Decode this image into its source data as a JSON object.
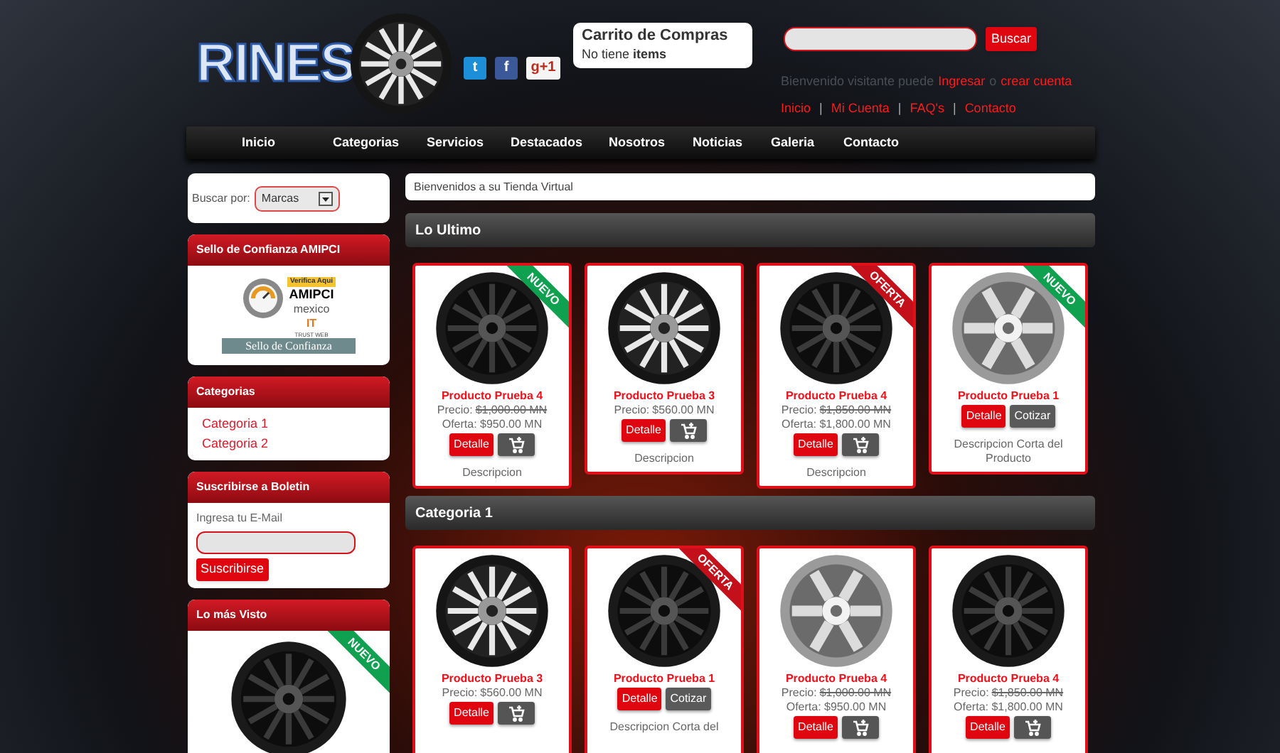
{
  "logo": {
    "text": "RINES"
  },
  "social": [
    {
      "kind": "twitter",
      "label": "t"
    },
    {
      "kind": "facebook",
      "label": "f"
    },
    {
      "kind": "gplus",
      "label": "g+1"
    }
  ],
  "cart": {
    "title": "Carrito de Compras",
    "status": "No tiene **items**"
  },
  "search": {
    "button": "Buscar"
  },
  "account": {
    "greeting": "Bienvenido visitante puede",
    "login": "Ingresar",
    "separator": "o",
    "register": "crear cuenta"
  },
  "top_links": {
    "separator": "|",
    "items": [
      "Inicio",
      "Mi Cuenta",
      "FAQ's",
      "Contacto"
    ]
  },
  "nav": [
    "Inicio",
    "Categorias",
    "Servicios",
    "Destacados",
    "Nosotros",
    "Noticias",
    "Galeria",
    "Contacto"
  ],
  "sidebar": {
    "search_by": {
      "label": "Buscar por:",
      "value": "Marcas"
    },
    "seal": {
      "title": "Sello de Confianza AMIPCI",
      "badge_top": "Verifica Aqui",
      "badge_brand": "AMIPCI",
      "badge_mexico": "mexico",
      "badge_it": "IT",
      "badge_trust": "TRUST WEB",
      "badge_bottom": "Sello de Confianza"
    },
    "categories": {
      "title": "Categorias",
      "items": [
        "Categoria 1",
        "Categoria 2"
      ]
    },
    "newsletter": {
      "title": "Suscribirse a Boletin",
      "label": "Ingresa tu E-Mail",
      "button": "Suscribirse"
    },
    "most_viewed": {
      "title": "Lo más Visto",
      "ribbon": {
        "kind": "new",
        "text": "NUEVO"
      }
    }
  },
  "welcome": "Bienvenidos a su Tienda Virtual",
  "sections": [
    {
      "title": "Lo Ultimo",
      "products": [
        {
          "kind": "black",
          "ribbon": {
            "kind": "new",
            "text": "NUEVO"
          },
          "name": "Producto Prueba 4",
          "price_label": "Precio:",
          "price": "$1,000.00 MN",
          "struck": true,
          "offer": "Oferta: $950.00 MN",
          "detail": "Detalle",
          "action": {
            "kind": "cart"
          },
          "description": "Descripcion"
        },
        {
          "kind": "chrome",
          "name": "Producto Prueba 3",
          "price_label": "Precio:",
          "price": "$560.00 MN",
          "struck": false,
          "detail": "Detalle",
          "action": {
            "kind": "cart"
          },
          "description": "Descripcion"
        },
        {
          "kind": "black",
          "ribbon": {
            "kind": "sale",
            "text": "OFERTA"
          },
          "name": "Producto Prueba 4",
          "price_label": "Precio:",
          "price": "$1,850.00 MN",
          "struck": true,
          "offer": "Oferta: $1,800.00 MN",
          "detail": "Detalle",
          "action": {
            "kind": "cart"
          },
          "description": "Descripcion"
        },
        {
          "kind": "silver",
          "ribbon": {
            "kind": "new",
            "text": "NUEVO"
          },
          "name": "Producto Prueba 1",
          "detail": "Detalle",
          "action": {
            "kind": "quote",
            "label": "Cotizar"
          },
          "description": "Descripcion Corta del Producto"
        }
      ]
    },
    {
      "title": "Categoria 1",
      "products": [
        {
          "kind": "chrome",
          "name": "Producto Prueba 3",
          "price_label": "Precio:",
          "price": "$560.00 MN",
          "struck": false,
          "detail": "Detalle",
          "action": {
            "kind": "cart"
          }
        },
        {
          "kind": "black",
          "ribbon": {
            "kind": "sale",
            "text": "OFERTA"
          },
          "name": "Producto Prueba 1",
          "detail": "Detalle",
          "action": {
            "kind": "quote",
            "label": "Cotizar"
          },
          "description": "Descripcion Corta del"
        },
        {
          "kind": "silver",
          "name": "Producto Prueba 4",
          "price_label": "Precio:",
          "price": "$1,000.00 MN",
          "struck": true,
          "offer": "Oferta: $950.00 MN",
          "detail": "Detalle",
          "action": {
            "kind": "cart"
          }
        },
        {
          "kind": "black",
          "name": "Producto Prueba 4",
          "price_label": "Precio:",
          "price": "$1,850.00 MN",
          "struck": true,
          "offer": "Oferta: $1,800.00 MN",
          "detail": "Detalle",
          "action": {
            "kind": "cart"
          }
        }
      ]
    }
  ]
}
